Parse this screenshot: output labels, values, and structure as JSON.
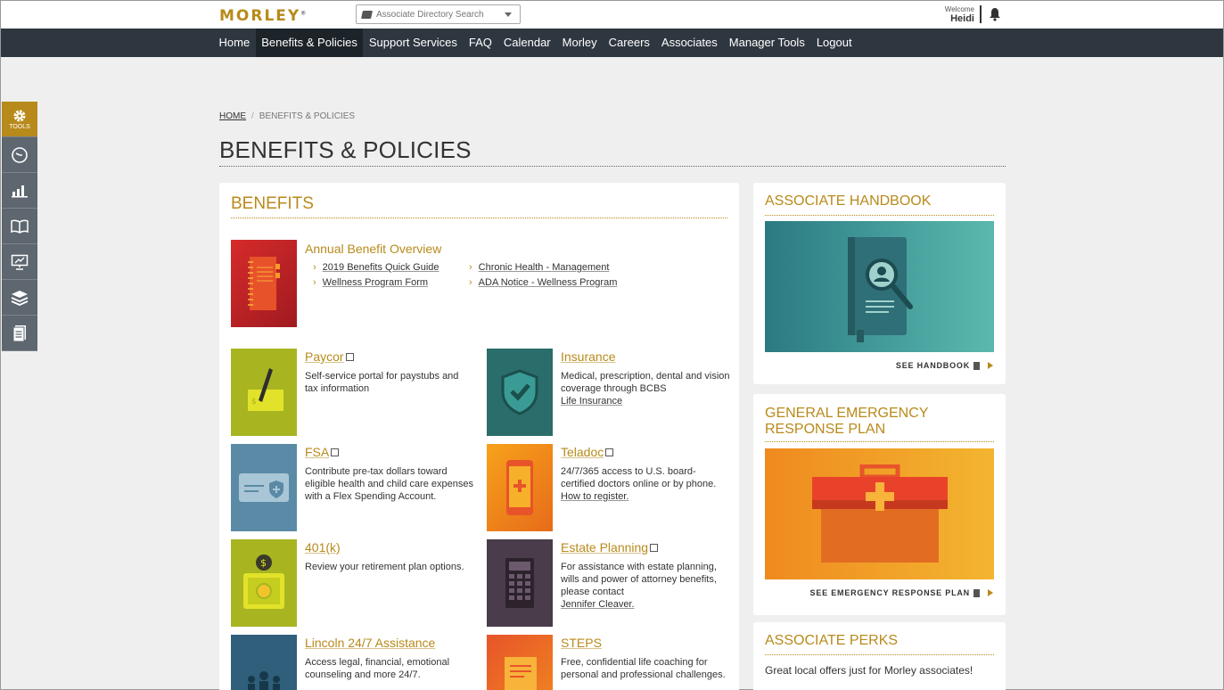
{
  "header": {
    "logo": "MORLEY",
    "logo_mark": "®",
    "search_placeholder": "Associate Directory Search",
    "welcome_label": "Welcome",
    "user_name": "Heidi"
  },
  "nav": [
    "Home",
    "Benefits & Policies",
    "Support Services",
    "FAQ",
    "Calendar",
    "Morley",
    "Careers",
    "Associates",
    "Manager Tools",
    "Logout"
  ],
  "sidebar": {
    "tools_label": "TOOLS",
    "icons": [
      "gear-icon",
      "clock-icon",
      "bar-chart-icon",
      "book-icon",
      "presentation-icon",
      "layers-icon",
      "document-icon"
    ]
  },
  "breadcrumb": {
    "home": "HOME",
    "separator": "/",
    "current": "BENEFITS & POLICIES"
  },
  "page_title": "BENEFITS & POLICIES",
  "benefits": {
    "title": "BENEFITS",
    "overview": {
      "title": "Annual Benefit Overview",
      "links": [
        "2019 Benefits Quick Guide",
        "Chronic Health - Management",
        "Wellness Program Form",
        "ADA Notice - Wellness Program"
      ]
    },
    "items": [
      {
        "title": "Paycor",
        "desc": "Self-service portal for paystubs and tax information",
        "link": ""
      },
      {
        "title": "Insurance",
        "desc": "Medical, prescription, dental and vision coverage through BCBS",
        "link": "Life Insurance"
      },
      {
        "title": "FSA",
        "desc": "Contribute pre-tax dollars toward eligible health and child care expenses with a Flex Spending Account.",
        "link": ""
      },
      {
        "title": "Teladoc",
        "desc": "24/7/365 access to U.S. board-certified doctors online or by phone.",
        "link": "How to register."
      },
      {
        "title": "401(k)",
        "desc": "Review your retirement plan options.",
        "link": ""
      },
      {
        "title": "Estate Planning",
        "desc": "For assistance with estate planning, wills and power of attorney benefits, please contact",
        "link": "Jennifer Cleaver."
      },
      {
        "title": "Lincoln 24/7 Assistance",
        "desc": "Access legal, financial, emotional counseling and more 24/7.",
        "link": ""
      },
      {
        "title": "STEPS",
        "desc": "Free, confidential life coaching for personal and professional challenges.",
        "link": ""
      }
    ]
  },
  "handbook": {
    "title": "ASSOCIATE HANDBOOK",
    "link": "SEE HANDBOOK"
  },
  "emergency": {
    "title_line1": "GENERAL EMERGENCY",
    "title_line2": "RESPONSE PLAN",
    "link": "SEE EMERGENCY RESPONSE PLAN"
  },
  "perks": {
    "title": "ASSOCIATE PERKS",
    "text": "Great local offers just for Morley associates!"
  },
  "colors": {
    "accent": "#b88a1b",
    "nav_bg": "#2e3740",
    "sidebar_bg": "#5e6770"
  }
}
